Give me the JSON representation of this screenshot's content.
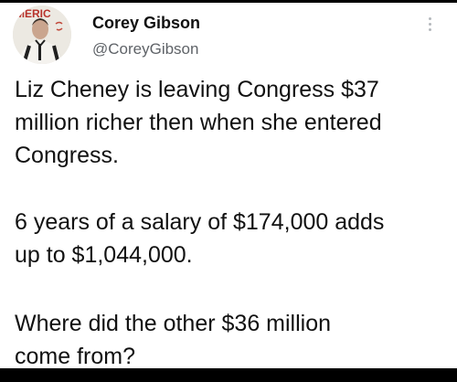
{
  "tweet": {
    "author": {
      "display_name": "Corey Gibson",
      "handle": "@CoreyGibson",
      "avatar_icon": "profile-photo",
      "avatar_sign_text": "MERIC"
    },
    "more_icon": "more-options-icon",
    "paragraphs": [
      {
        "lines": [
          "Liz Cheney is leaving Congress $37",
          "million richer then when she entered",
          "Congress."
        ]
      },
      {
        "lines": [
          "6 years of a salary of $174,000 adds",
          "up to $1,044,000."
        ]
      },
      {
        "lines": [
          "Where did the other $36 million",
          "come from?"
        ]
      }
    ]
  },
  "colors": {
    "text": "#111111",
    "handle": "#5f6368",
    "background": "#ffffff",
    "frame": "#000000"
  }
}
